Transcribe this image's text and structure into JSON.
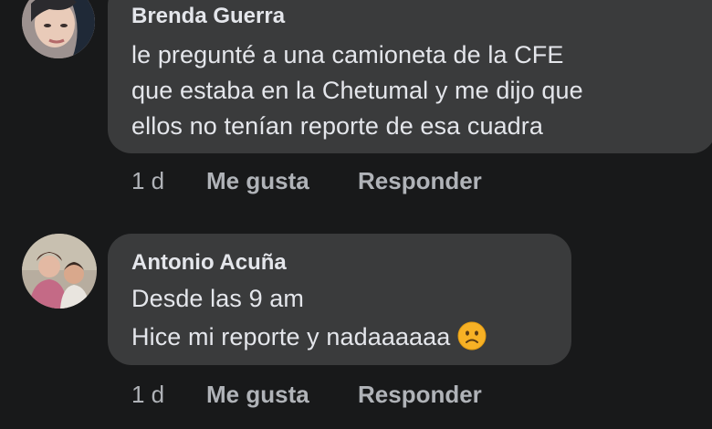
{
  "comments": [
    {
      "author": "Brenda Guerra",
      "lines": [
        "le pregunté a una camioneta de la CFE",
        "que estaba en la Chetumal y me dijo que",
        "ellos no tenían reporte de esa cuadra"
      ],
      "time": "1 d",
      "like_label": "Me gusta",
      "reply_label": "Responder"
    },
    {
      "author": "Antonio Acuña",
      "lines": [
        "Desde las 9 am",
        "Hice mi reporte y nadaaaaaa"
      ],
      "emoji": "frowning-face-emoji",
      "time": "1 d",
      "like_label": "Me gusta",
      "reply_label": "Responder"
    }
  ],
  "colors": {
    "background": "#18191a",
    "bubble": "#3a3b3c",
    "text": "#e4e6eb",
    "secondary_text": "#b0b3b8",
    "emoji": "#f7b125"
  }
}
